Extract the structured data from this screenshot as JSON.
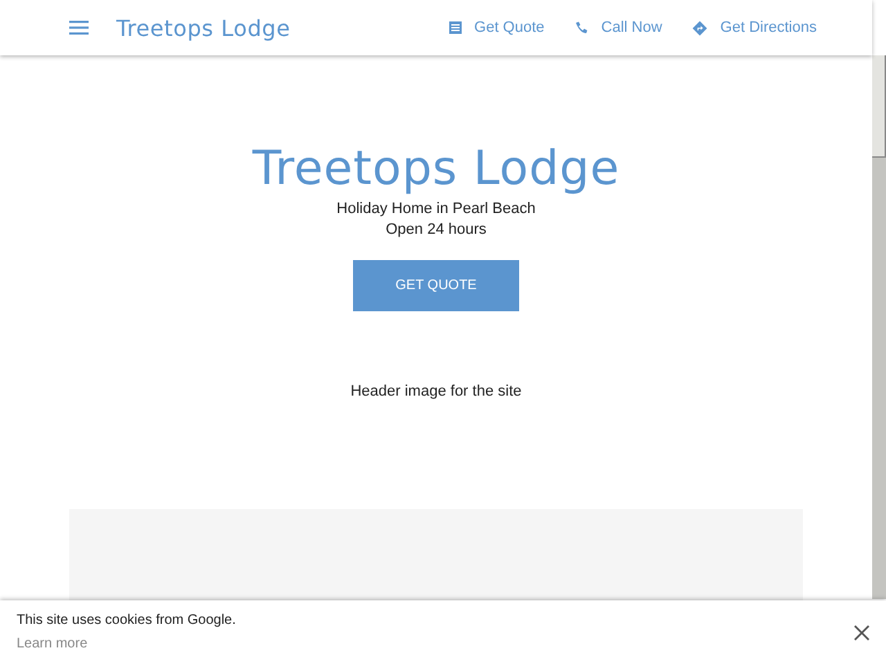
{
  "header": {
    "title": "Treetops Lodge",
    "actions": [
      {
        "kind": "quote",
        "label": "Get Quote"
      },
      {
        "kind": "call",
        "label": "Call Now"
      },
      {
        "kind": "directions",
        "label": "Get Directions"
      }
    ]
  },
  "hero": {
    "title": "Treetops Lodge",
    "subtitle": "Holiday Home in Pearl Beach",
    "hours": "Open 24 hours",
    "button": "GET QUOTE",
    "image_caption": "Header image for the site"
  },
  "cookie_banner": {
    "message": "This site uses cookies from Google.",
    "link": "Learn more"
  }
}
